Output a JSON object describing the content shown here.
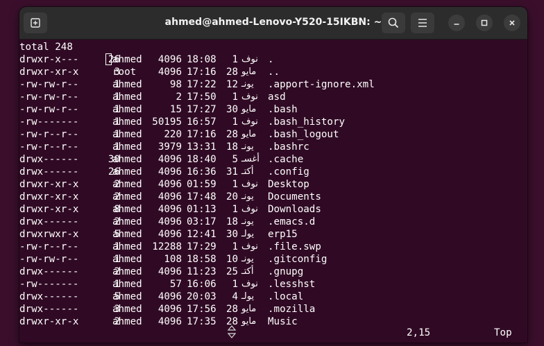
{
  "window": {
    "title": "ahmed@ahmed-Lenovo-Y520-15IKBN: ~",
    "icons": [
      "new-tab-icon",
      "search-icon",
      "hamburger-menu-icon",
      "minimize-icon",
      "maximize-icon",
      "close-icon"
    ]
  },
  "terminal": {
    "total": "total 248",
    "rows": [
      {
        "perm": "drwxr-x---",
        "links": "26",
        "owner": "ahmed",
        "size": "4096",
        "time": "18:08",
        "day": "1",
        "month": "نوف",
        "name": "."
      },
      {
        "perm": "drwxr-xr-x",
        "links": "3",
        "owner": "root",
        "size": "4096",
        "time": "17:16",
        "day": "28",
        "month": "مايو",
        "name": ".."
      },
      {
        "perm": "-rw-rw-r--",
        "links": "1",
        "owner": "ahmed",
        "size": "98",
        "time": "17:22",
        "day": "12",
        "month": "يونـ",
        "name": ".apport-ignore.xml"
      },
      {
        "perm": "-rw-rw-r--",
        "links": "1",
        "owner": "ahmed",
        "size": "2",
        "time": "17:50",
        "day": "1",
        "month": "نوف",
        "name": "asd"
      },
      {
        "perm": "-rw-rw-r--",
        "links": "1",
        "owner": "ahmed",
        "size": "15",
        "time": "17:27",
        "day": "30",
        "month": "مايو",
        "name": ".bash"
      },
      {
        "perm": "-rw-------",
        "links": "1",
        "owner": "ahmed",
        "size": "50195",
        "time": "16:57",
        "day": "1",
        "month": "نوف",
        "name": ".bash_history"
      },
      {
        "perm": "-rw-r--r--",
        "links": "1",
        "owner": "ahmed",
        "size": "220",
        "time": "17:16",
        "day": "28",
        "month": "مايو",
        "name": ".bash_logout"
      },
      {
        "perm": "-rw-r--r--",
        "links": "1",
        "owner": "ahmed",
        "size": "3979",
        "time": "13:31",
        "day": "18",
        "month": "يونـ",
        "name": ".bashrc"
      },
      {
        "perm": "drwx------",
        "links": "30",
        "owner": "ahmed",
        "size": "4096",
        "time": "18:40",
        "day": "5",
        "month": "أغسـ",
        "name": ".cache"
      },
      {
        "perm": "drwx------",
        "links": "26",
        "owner": "ahmed",
        "size": "4096",
        "time": "16:36",
        "day": "31",
        "month": "أكتـ",
        "name": ".config"
      },
      {
        "perm": "drwxr-xr-x",
        "links": "2",
        "owner": "ahmed",
        "size": "4096",
        "time": "01:59",
        "day": "1",
        "month": "نوف",
        "name": "Desktop"
      },
      {
        "perm": "drwxr-xr-x",
        "links": "2",
        "owner": "ahmed",
        "size": "4096",
        "time": "17:48",
        "day": "20",
        "month": "يونـ",
        "name": "Documents"
      },
      {
        "perm": "drwxr-xr-x",
        "links": "8",
        "owner": "ahmed",
        "size": "4096",
        "time": "01:13",
        "day": "1",
        "month": "نوف",
        "name": "Downloads"
      },
      {
        "perm": "drwx------",
        "links": "2",
        "owner": "ahmed",
        "size": "4096",
        "time": "03:17",
        "day": "18",
        "month": "يونـ",
        "name": ".emacs.d"
      },
      {
        "perm": "drwxrwxr-x",
        "links": "5",
        "owner": "ahmed",
        "size": "4096",
        "time": "12:41",
        "day": "30",
        "month": "يولـ",
        "name": "erp15"
      },
      {
        "perm": "-rw-r--r--",
        "links": "1",
        "owner": "ahmed",
        "size": "12288",
        "time": "17:29",
        "day": "1",
        "month": "نوف",
        "name": ".file.swp"
      },
      {
        "perm": "-rw-rw-r--",
        "links": "1",
        "owner": "ahmed",
        "size": "108",
        "time": "18:58",
        "day": "10",
        "month": "يونـ",
        "name": ".gitconfig"
      },
      {
        "perm": "drwx------",
        "links": "2",
        "owner": "ahmed",
        "size": "4096",
        "time": "11:23",
        "day": "25",
        "month": "أكتـ",
        "name": ".gnupg"
      },
      {
        "perm": "-rw-------",
        "links": "1",
        "owner": "ahmed",
        "size": "57",
        "time": "16:06",
        "day": "1",
        "month": "نوف",
        "name": ".lesshst"
      },
      {
        "perm": "drwx------",
        "links": "5",
        "owner": "ahmed",
        "size": "4096",
        "time": "20:03",
        "day": "4",
        "month": "يولـ",
        "name": ".local"
      },
      {
        "perm": "drwx------",
        "links": "3",
        "owner": "ahmed",
        "size": "4096",
        "time": "17:56",
        "day": "28",
        "month": "مايو",
        "name": ".mozilla"
      },
      {
        "perm": "drwxr-xr-x",
        "links": "2",
        "owner": "ahmed",
        "size": "4096",
        "time": "17:35",
        "day": "28",
        "month": "مايو",
        "name": "Music"
      }
    ],
    "status": {
      "position": "2,15",
      "scroll": "Top"
    }
  },
  "colors": {
    "background": "#300a24",
    "titlebar": "#2c2c2c",
    "text": "#ffffff"
  }
}
